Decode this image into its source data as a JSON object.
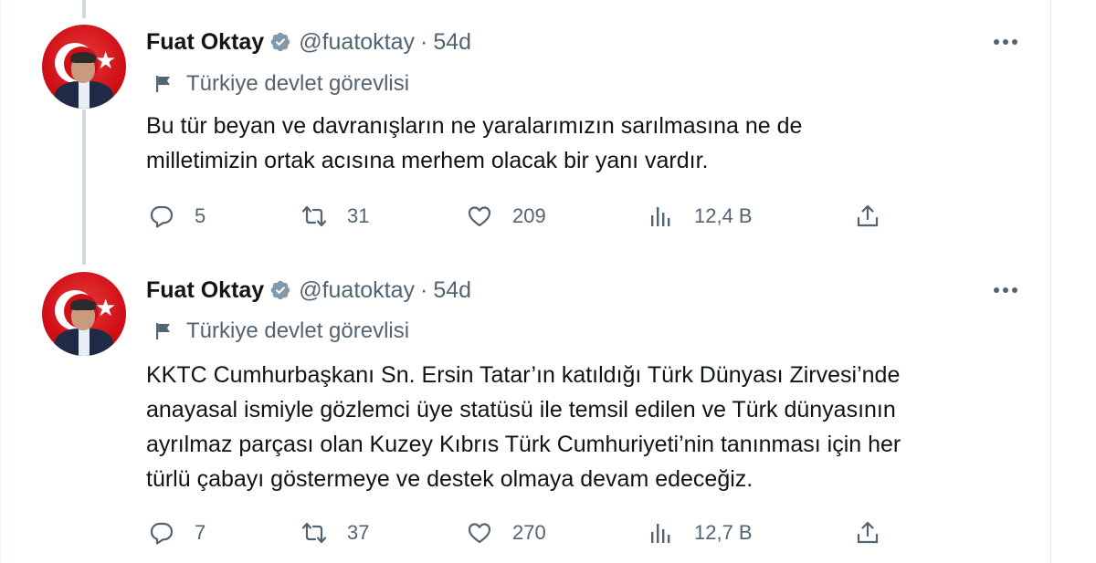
{
  "colors": {
    "text": "#0f1419",
    "secondary": "#536471",
    "verified_badge": "#829aab",
    "thread_line": "#cfd9de",
    "avatar_red": "#d10f17"
  },
  "icons": [
    "verified-badge-icon",
    "more-icon",
    "government-flag-icon",
    "reply-icon",
    "retweet-icon",
    "like-icon",
    "views-icon",
    "share-icon"
  ],
  "tweets": [
    {
      "author_name": "Fuat Oktay",
      "handle": "@fuatoktay",
      "separator": "·",
      "time": "54d",
      "label": "Türkiye devlet görevlisi",
      "text": "Bu tür beyan ve davranışların ne yaralarımızın sarılmasına ne de\nmilletimizin ortak acısına merhem olacak bir yanı vardır.",
      "replies": "5",
      "retweets": "31",
      "likes": "209",
      "views": "12,4 B"
    },
    {
      "author_name": "Fuat Oktay",
      "handle": "@fuatoktay",
      "separator": "·",
      "time": "54d",
      "label": "Türkiye devlet görevlisi",
      "text": "KKTC Cumhurbaşkanı Sn. Ersin Tatar’ın katıldığı Türk Dünyası Zirvesi’nde\nanayasal ismiyle gözlemci üye statüsü ile temsil edilen ve Türk dünyasının\nayrılmaz parçası olan Kuzey Kıbrıs Türk Cumhuriyeti’nin tanınması için her\ntürlü çabayı göstermeye ve destek olmaya devam edeceğiz.",
      "replies": "7",
      "retweets": "37",
      "likes": "270",
      "views": "12,7 B"
    }
  ]
}
